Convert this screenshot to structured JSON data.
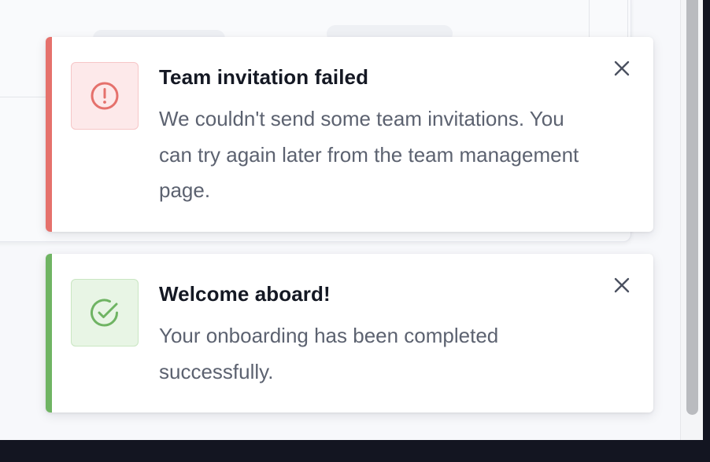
{
  "notifications": [
    {
      "type": "error",
      "title": "Team invitation failed",
      "message": "We couldn't send some team invitations. You can try again later from the team management page.",
      "icon": "alert-circle-icon",
      "accent_color": "#e5716c"
    },
    {
      "type": "success",
      "title": "Welcome aboard!",
      "message": "Your onboarding has been completed successfully.",
      "icon": "check-circle-icon",
      "accent_color": "#6fb463"
    }
  ],
  "colors": {
    "error": "#e5716c",
    "success": "#6fb463",
    "title_text": "#141823",
    "body_text": "#5c6270",
    "close_icon": "#4b5160"
  }
}
